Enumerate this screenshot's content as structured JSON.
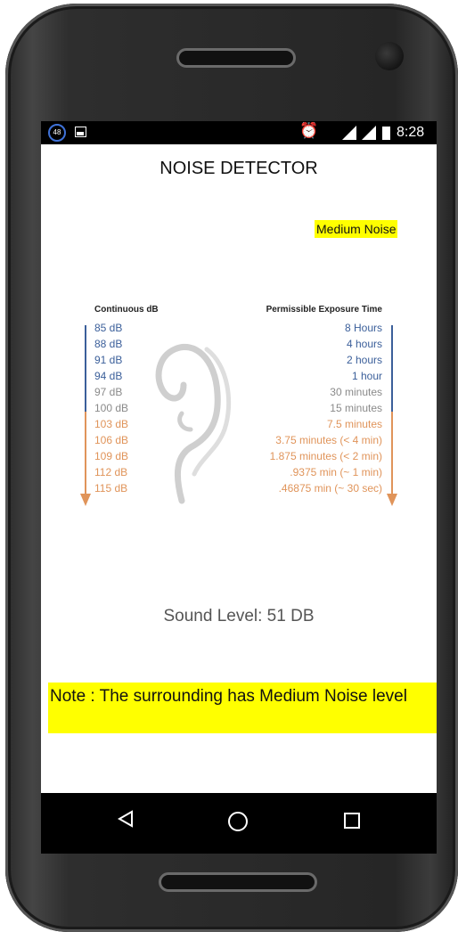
{
  "status_bar": {
    "notification_count": "48",
    "time": "8:28"
  },
  "app": {
    "title": "NOISE DETECTOR",
    "noise_badge": "Medium Noise",
    "sound_level": "Sound Level: 51 DB",
    "note": "Note : The surrounding has Medium Noise level"
  },
  "exposure_chart": {
    "left_header": "Continuous dB",
    "right_header": "Permissible Exposure Time",
    "db_levels": [
      "85 dB",
      "88 dB",
      "91 dB",
      "94 dB",
      "97 dB",
      "100 dB",
      "103 dB",
      "106 dB",
      "109 dB",
      "112 dB",
      "115 dB"
    ],
    "exposure_times": [
      "8 Hours",
      "4 hours",
      "2 hours",
      "1 hour",
      "30 minutes",
      "15 minutes",
      "7.5 minutes",
      "3.75 minutes (< 4 min)",
      "1.875 minutes (< 2 min)",
      ".9375 min (~ 1 min)",
      ".46875 min (~ 30 sec)"
    ],
    "colors": {
      "low": "#3b5f9a",
      "mid": "#8a8a8a",
      "high": "#e0945a",
      "header": "#222222"
    }
  },
  "colors": {
    "highlight": "#ffff00",
    "phone_body": "#2b2b2b",
    "status_icon_accent": "#3f72d8"
  },
  "nav_icons": [
    "back-icon",
    "home-icon",
    "recent-apps-icon"
  ]
}
